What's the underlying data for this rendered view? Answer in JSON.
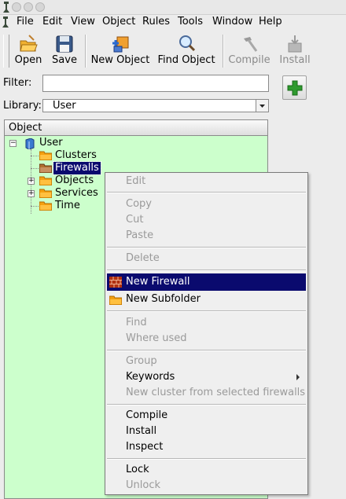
{
  "menubar": {
    "items": [
      "File",
      "Edit",
      "View",
      "Object",
      "Rules",
      "Tools",
      "Window",
      "Help"
    ]
  },
  "toolbar": {
    "buttons": [
      {
        "label": "Open",
        "icon": "open-folder-icon",
        "enabled": true
      },
      {
        "label": "Save",
        "icon": "floppy-disk-icon",
        "enabled": true
      },
      {
        "label": "New Object",
        "icon": "new-object-icon",
        "enabled": true
      },
      {
        "label": "Find Object",
        "icon": "magnifier-icon",
        "enabled": true
      },
      {
        "label": "Compile",
        "icon": "hammer-icon",
        "enabled": false
      },
      {
        "label": "Install",
        "icon": "install-icon",
        "enabled": false
      }
    ]
  },
  "filter": {
    "label": "Filter:",
    "value": ""
  },
  "library": {
    "label": "Library:",
    "selected": "User"
  },
  "tree": {
    "header": "Object",
    "root": "User",
    "children": [
      "Clusters",
      "Firewalls",
      "Objects",
      "Services",
      "Time"
    ],
    "selected": "Firewalls"
  },
  "context_menu": {
    "items": [
      {
        "label": "Edit",
        "enabled": false
      },
      {
        "label": "Copy",
        "enabled": false
      },
      {
        "label": "Cut",
        "enabled": false
      },
      {
        "label": "Paste",
        "enabled": false
      },
      {
        "label": "Delete",
        "enabled": false
      },
      {
        "label": "New Firewall",
        "enabled": true,
        "highlighted": true,
        "icon": "firewall-brick-icon"
      },
      {
        "label": "New Subfolder",
        "enabled": true,
        "icon": "folder-icon"
      },
      {
        "label": "Find",
        "enabled": false
      },
      {
        "label": "Where used",
        "enabled": false
      },
      {
        "label": "Group",
        "enabled": false
      },
      {
        "label": "Keywords",
        "enabled": true,
        "submenu": true
      },
      {
        "label": "New cluster from selected firewalls",
        "enabled": false
      },
      {
        "label": "Compile",
        "enabled": true
      },
      {
        "label": "Install",
        "enabled": true
      },
      {
        "label": "Inspect",
        "enabled": true
      },
      {
        "label": "Lock",
        "enabled": true
      },
      {
        "label": "Unlock",
        "enabled": false
      }
    ]
  },
  "colors": {
    "tree_background": "#ccffcc",
    "selection": "#0a0a6e",
    "add_button_green": "#2e9a2e"
  }
}
